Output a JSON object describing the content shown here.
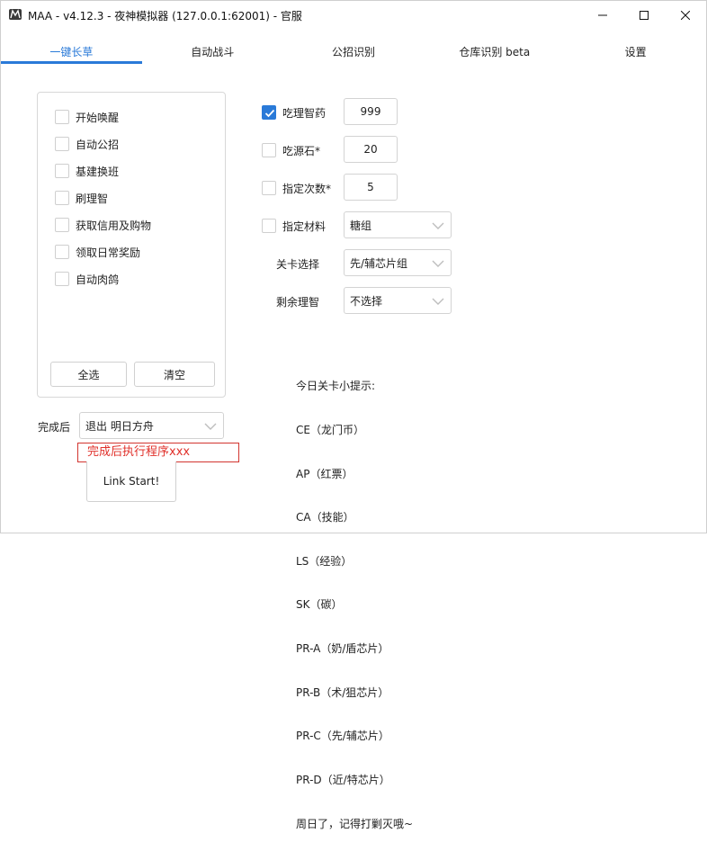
{
  "window": {
    "title": "MAA - v4.12.3 - 夜神模拟器 (127.0.0.1:62001) - 官服",
    "minimize_glyph": "—",
    "maximize_glyph": "☐",
    "close_glyph": "✕"
  },
  "tabs": [
    {
      "label": "一键长草",
      "active": true
    },
    {
      "label": "自动战斗"
    },
    {
      "label": "公招识别"
    },
    {
      "label": "仓库识别 beta"
    },
    {
      "label": "设置"
    }
  ],
  "tasks": [
    {
      "label": "开始唤醒",
      "checked": false
    },
    {
      "label": "自动公招",
      "checked": false
    },
    {
      "label": "基建换班",
      "checked": false
    },
    {
      "label": "刷理智",
      "checked": false
    },
    {
      "label": "获取信用及购物",
      "checked": false
    },
    {
      "label": "领取日常奖励",
      "checked": false
    },
    {
      "label": "自动肉鸽",
      "checked": false
    }
  ],
  "buttons": {
    "select_all": "全选",
    "clear": "清空",
    "link_start": "Link Start!"
  },
  "after_complete": {
    "label": "完成后",
    "selected": "退出 明日方舟",
    "command_text": "完成后执行程序xxx"
  },
  "settings": {
    "medicine": {
      "label": "吃理智药",
      "checked": true,
      "value": "999"
    },
    "stone": {
      "label": "吃源石*",
      "checked": false,
      "value": "20"
    },
    "times": {
      "label": "指定次数*",
      "checked": false,
      "value": "5"
    },
    "material": {
      "label": "指定材料",
      "checked": false,
      "selected": "糖组"
    },
    "stage": {
      "label": "关卡选择",
      "selected": "先/辅芯片组"
    },
    "remaining": {
      "label": "剩余理智",
      "selected": "不选择"
    }
  },
  "tips": {
    "lines": [
      "今日关卡小提示:",
      "CE（龙门币）",
      "AP（红票）",
      "CA（技能）",
      "LS（经验）",
      "SK（碳）",
      "PR-A（奶/盾芯片）",
      "PR-B（术/狙芯片）",
      "PR-C（先/辅芯片）",
      "PR-D（近/特芯片）",
      "周日了，记得打剿灭哦~"
    ]
  },
  "colors": {
    "accent": "#2a7ad8",
    "command_border": "#d2352f"
  }
}
